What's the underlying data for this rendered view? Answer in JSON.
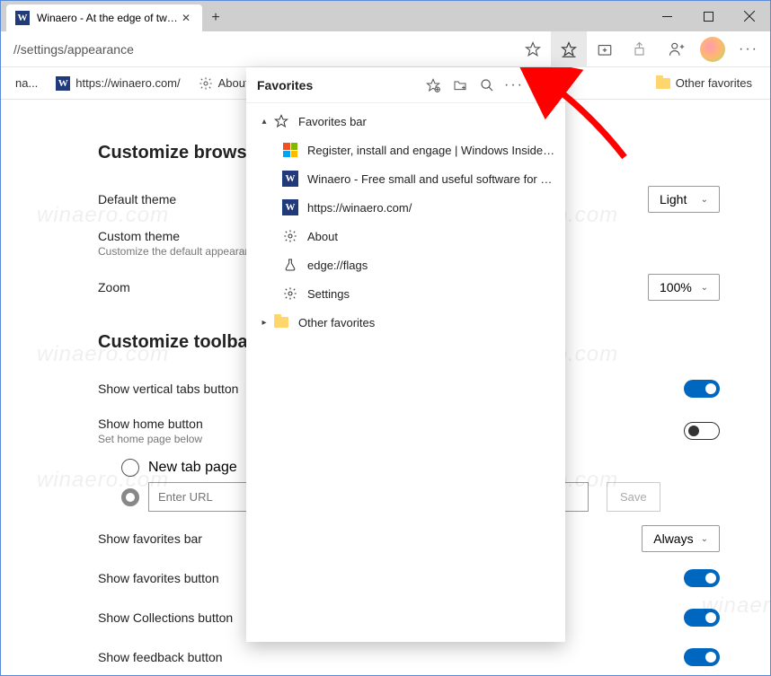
{
  "titlebar": {
    "tab_title": "Winaero - At the edge of tweaki"
  },
  "addressbar": {
    "url": "//settings/appearance"
  },
  "bookmarks_bar": {
    "item_truncated": "na...",
    "item_winaero": "https://winaero.com/",
    "item_about": "About",
    "other_favorites": "Other favorites"
  },
  "favorites_panel": {
    "title": "Favorites",
    "favorites_bar_label": "Favorites bar",
    "items": [
      "Register, install and engage | Windows Insider Prog...",
      "Winaero - Free small and useful software for Wind...",
      "https://winaero.com/",
      "About",
      "edge://flags",
      "Settings"
    ],
    "other_favorites": "Other favorites"
  },
  "settings": {
    "section_browser": "Customize browser",
    "default_theme_label": "Default theme",
    "default_theme_value": "Light",
    "custom_theme_label": "Custom theme",
    "custom_theme_sub": "Customize the default appearance",
    "zoom_label": "Zoom",
    "zoom_value": "100%",
    "section_toolbar": "Customize toolbar",
    "vertical_tabs": "Show vertical tabs button",
    "vertical_tabs_on": true,
    "home_button": "Show home button",
    "home_button_on": false,
    "home_button_sub": "Set home page below",
    "radio_newtab": "New tab page",
    "url_placeholder": "Enter URL",
    "save_label": "Save",
    "favorites_bar_label": "Show favorites bar",
    "favorites_bar_value": "Always",
    "favorites_button": "Show favorites button",
    "favorites_button_on": true,
    "collections_button": "Show Collections button",
    "collections_button_on": true,
    "feedback_button": "Show feedback button",
    "feedback_button_on": true
  },
  "watermark": "winaero.com"
}
